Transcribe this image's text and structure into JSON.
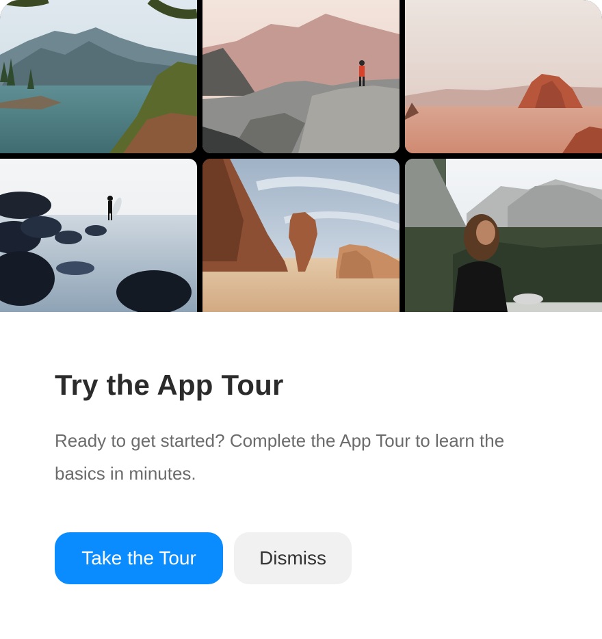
{
  "dialog": {
    "title": "Try the App Tour",
    "description": "Ready to get started? Complete the App Tour to learn the basics in minutes.",
    "primary_button": "Take the Tour",
    "secondary_button": "Dismiss"
  },
  "gallery": {
    "photos": [
      {
        "subject": "mountain lake with pine trees"
      },
      {
        "subject": "person in red jacket standing on rocks under hazy mountains"
      },
      {
        "subject": "red rock formation in misty desert"
      },
      {
        "subject": "surfer walking on rocky beach"
      },
      {
        "subject": "sandstone pillars in desert"
      },
      {
        "subject": "woman looking at mountain valley"
      }
    ]
  },
  "colors": {
    "primary": "#0a8cff",
    "secondary_bg": "#f1f1f1",
    "title": "#2b2b2b",
    "description": "#6b6b6b"
  }
}
